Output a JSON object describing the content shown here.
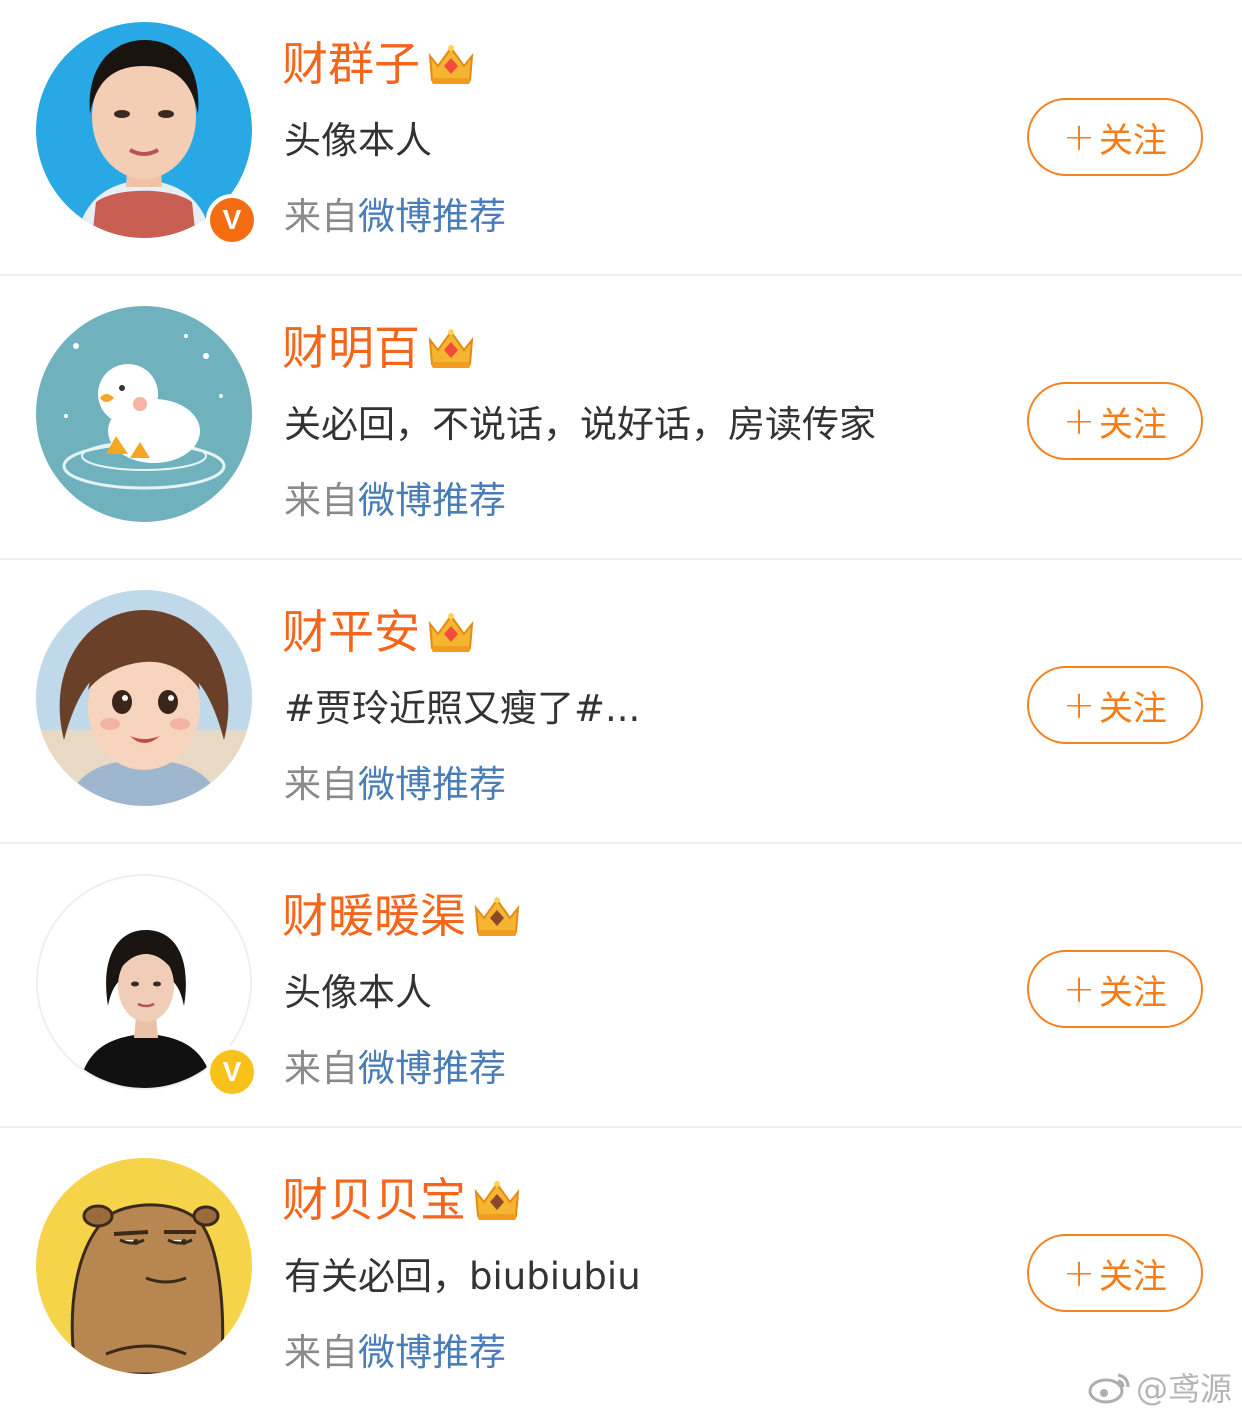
{
  "users": [
    {
      "name": "财群子",
      "description": "头像本人",
      "source_prefix": "来自",
      "source_link": "微博推荐",
      "follow_label": "关注",
      "follow_plus": "+",
      "avatar_icon": "avatar-photo-woman-blue-background",
      "verified": true,
      "verified_badge": "V",
      "verified_color": "#f56c12"
    },
    {
      "name": "财明百",
      "description": "关必回，不说话，说好话，房读传家",
      "source_prefix": "来自",
      "source_link": "微博推荐",
      "follow_label": "关注",
      "follow_plus": "+",
      "avatar_icon": "avatar-cartoon-duck",
      "verified": false
    },
    {
      "name": "财平安",
      "description": "#贾玲近照又瘦了#...",
      "source_prefix": "来自",
      "source_link": "微博推荐",
      "follow_label": "关注",
      "follow_plus": "+",
      "avatar_icon": "avatar-illustrated-girl",
      "verified": false
    },
    {
      "name": "财暖暖渠",
      "description": "头像本人",
      "source_prefix": "来自",
      "source_link": "微博推荐",
      "follow_label": "关注",
      "follow_plus": "+",
      "avatar_icon": "avatar-photo-woman-white-background",
      "verified": true,
      "verified_badge": "V",
      "verified_color": "#f9c21a"
    },
    {
      "name": "财贝贝宝",
      "description": "有关必回，biubiubiu",
      "source_prefix": "来自",
      "source_link": "微博推荐",
      "follow_label": "关注",
      "follow_plus": "+",
      "avatar_icon": "avatar-cartoon-capybara",
      "verified": false
    }
  ],
  "watermark": {
    "text": "@鸢源",
    "icon": "weibo-logo-icon"
  },
  "colors": {
    "name": "#f4661b",
    "follow_border": "#f58220",
    "source_link": "#4a7db8",
    "source_prefix": "#8a8a8a",
    "description": "#333333"
  }
}
